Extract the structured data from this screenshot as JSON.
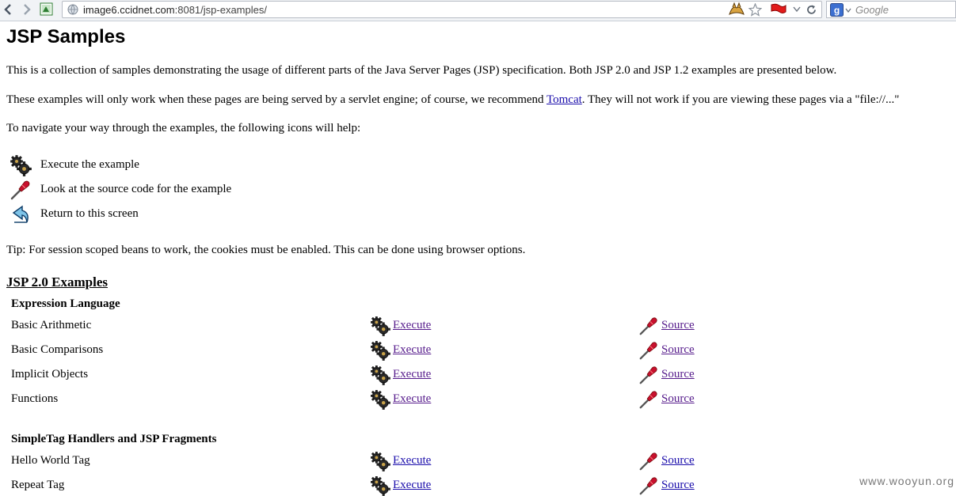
{
  "browser": {
    "url_host": "image6.ccidnet.com",
    "url_rest": ":8081/jsp-examples/",
    "search_placeholder": "Google",
    "icons": [
      "back-icon",
      "forward-icon",
      "page-favicon",
      "globe-icon",
      "tomcat-icon",
      "star-icon",
      "flag-icon",
      "dropdown-icon",
      "reload-icon",
      "google-icon"
    ]
  },
  "page": {
    "title": "JSP Samples",
    "intro1": "This is a collection of samples demonstrating the usage of different parts of the Java Server Pages (JSP) specification. Both JSP 2.0 and JSP 1.2 examples are presented below.",
    "intro2_before": "These examples will only work when these pages are being served by a servlet engine; of course, we recommend ",
    "intro2_link": "Tomcat",
    "intro2_after": ". They will not work if you are viewing these pages via a \"file://...\"",
    "intro3": "To navigate your way through the examples, the following icons will help:",
    "legend": [
      {
        "icon": "gears-icon",
        "text": "Execute the example"
      },
      {
        "icon": "screwdriver-icon",
        "text": "Look at the source code for the example"
      },
      {
        "icon": "return-arrow-icon",
        "text": "Return to this screen"
      }
    ],
    "tip": "Tip: For session scoped beans to work, the cookies must be enabled. This can be done using browser options.",
    "section": "JSP 2.0 Examples",
    "groups": [
      {
        "title": "Expression Language",
        "rows": [
          {
            "label": "Basic Arithmetic",
            "execute": "Execute",
            "source": "Source"
          },
          {
            "label": "Basic Comparisons",
            "execute": "Execute",
            "source": "Source"
          },
          {
            "label": "Implicit Objects",
            "execute": "Execute",
            "source": "Source"
          },
          {
            "label": "Functions",
            "execute": "Execute",
            "source": "Source"
          }
        ]
      },
      {
        "title": "SimpleTag Handlers and JSP Fragments",
        "rows": [
          {
            "label": "Hello World Tag",
            "execute": "Execute",
            "source": "Source"
          },
          {
            "label": "Repeat Tag",
            "execute": "Execute",
            "source": "Source"
          }
        ]
      }
    ]
  },
  "watermark": "www.wooyun.org",
  "colors": {
    "link": "#1a0dab",
    "visited_link": "#551a8b",
    "toolbar_bg": "#f1f3f6"
  }
}
